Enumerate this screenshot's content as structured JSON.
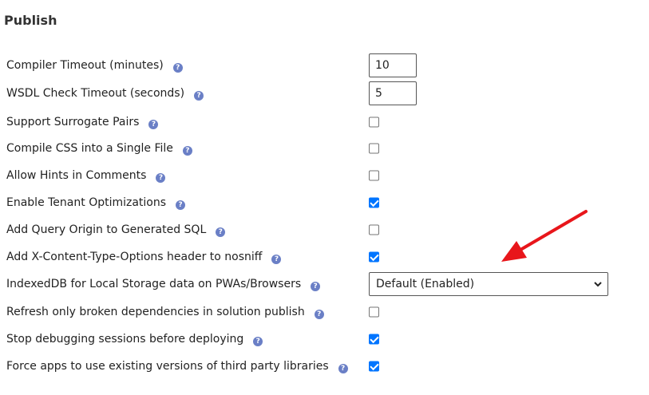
{
  "section": {
    "title": "Publish"
  },
  "settings": [
    {
      "label": "Compiler Timeout (minutes)",
      "control": "number",
      "value": "10"
    },
    {
      "label": "WSDL Check Timeout (seconds)",
      "control": "number",
      "value": "5"
    },
    {
      "label": "Support Surrogate Pairs",
      "control": "checkbox",
      "checked": false
    },
    {
      "label": "Compile CSS into a Single File",
      "control": "checkbox",
      "checked": false
    },
    {
      "label": "Allow Hints in Comments",
      "control": "checkbox",
      "checked": false
    },
    {
      "label": "Enable Tenant Optimizations",
      "control": "checkbox",
      "checked": true
    },
    {
      "label": "Add Query Origin to Generated SQL",
      "control": "checkbox",
      "checked": false
    },
    {
      "label": "Add X-Content-Type-Options header to nosniff",
      "control": "checkbox",
      "checked": true
    },
    {
      "label": "IndexedDB for Local Storage data on PWAs/Browsers",
      "control": "select",
      "value": "Default (Enabled)"
    },
    {
      "label": "Refresh only broken dependencies in solution publish",
      "control": "checkbox",
      "checked": false
    },
    {
      "label": "Stop debugging sessions before deploying",
      "control": "checkbox",
      "checked": true
    },
    {
      "label": "Force apps to use existing versions of third party libraries",
      "control": "checkbox",
      "checked": true
    }
  ],
  "help_icon_glyph": "?",
  "colors": {
    "help_icon": "#6a7fc6",
    "checkbox_checked": "#0075ff",
    "annotation_arrow": "#e8161b"
  }
}
